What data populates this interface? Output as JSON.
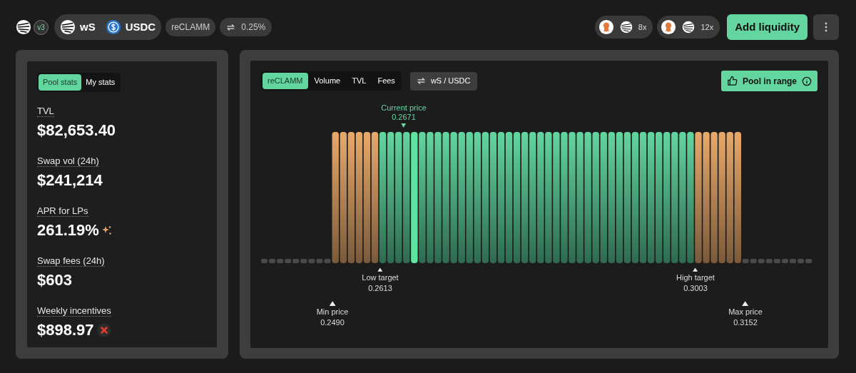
{
  "header": {
    "version": "v3",
    "tokens": [
      {
        "symbol": "wS",
        "kind": "ws"
      },
      {
        "symbol": "USDC",
        "kind": "usdc"
      }
    ],
    "pool_type": "reCLAMM",
    "fee": "0.25%",
    "boosts": [
      {
        "multiplier": "8x"
      },
      {
        "multiplier": "12x"
      }
    ],
    "add_button": "Add liquidity"
  },
  "stats_tabs": [
    {
      "label": "Pool stats",
      "selected": true
    },
    {
      "label": "My stats",
      "selected": false
    }
  ],
  "stats": [
    {
      "label": "TVL",
      "value": "$82,653.40",
      "kind": "plain"
    },
    {
      "label": "Swap vol (24h)",
      "value": "$241,214",
      "kind": "plain"
    },
    {
      "label": "APR for LPs",
      "value": "261.19%",
      "kind": "sparkle"
    },
    {
      "label": "Swap fees (24h)",
      "value": "$603",
      "kind": "plain"
    },
    {
      "label": "Weekly incentives",
      "value": "$898.97",
      "kind": "error"
    }
  ],
  "chart_tabs": [
    {
      "label": "reCLAMM",
      "selected": true
    },
    {
      "label": "Volume",
      "selected": false
    },
    {
      "label": "TVL",
      "selected": false
    },
    {
      "label": "Fees",
      "selected": false
    }
  ],
  "pair_toggle": "wS / USDC",
  "status": "Pool in range",
  "current_price": {
    "label": "Current price",
    "value": "0.2671"
  },
  "markers": [
    {
      "label": "Low target",
      "value": "0.2613",
      "kind": "low_target"
    },
    {
      "label": "High target",
      "value": "0.3003",
      "kind": "high_target"
    },
    {
      "label": "Min price",
      "value": "0.2490",
      "kind": "min"
    },
    {
      "label": "Max price",
      "value": "0.3152",
      "kind": "max"
    }
  ]
}
